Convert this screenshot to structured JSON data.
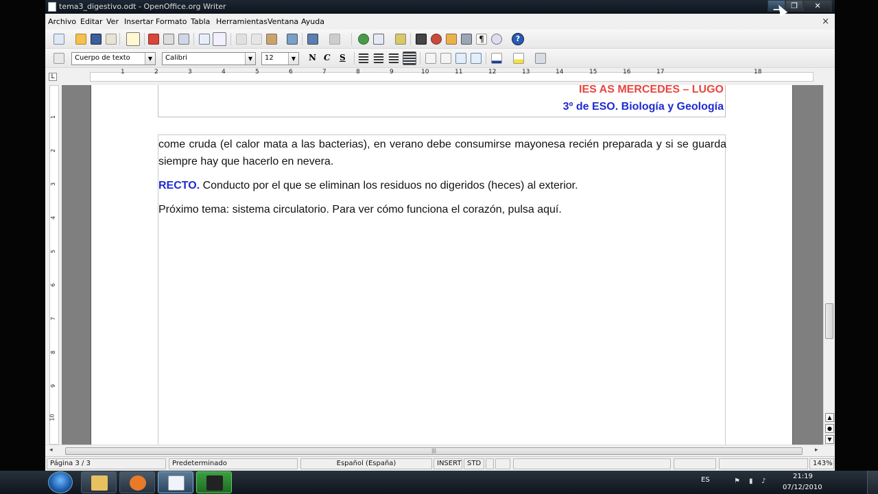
{
  "window": {
    "title": "tema3_digestivo.odt - OpenOffice.org Writer",
    "doc_close": "×"
  },
  "menu": [
    "Archivo",
    "Editar",
    "Ver",
    "Insertar",
    "Formato",
    "Tabla",
    "Herramientas",
    "Ventana",
    "Ayuda"
  ],
  "format_toolbar": {
    "style": "Cuerpo de texto",
    "font": "Calibri",
    "size": "12",
    "bold": "N",
    "italic": "C",
    "underline": "S"
  },
  "ruler": {
    "h_numbers": [
      "1",
      "2",
      "3",
      "4",
      "5",
      "6",
      "7",
      "8",
      "9",
      "10",
      "11",
      "12",
      "13",
      "14",
      "15",
      "16",
      "17",
      "18"
    ],
    "v_numbers": [
      "1",
      "2",
      "3",
      "4",
      "5",
      "6",
      "7",
      "8",
      "9",
      "10"
    ],
    "tab_selector": "L"
  },
  "document": {
    "header_line1": "IES AS MERCEDES – LUGO",
    "header_line2": "3º de ESO. Biología y Geología",
    "para1": "come cruda (el calor mata a las bacterias), en verano debe consumirse mayonesa recién preparada y si se guarda siempre hay que hacerlo en nevera.",
    "para2_keyword": "RECTO.",
    "para2_text": " Conducto por el que se eliminan los residuos no digeridos (heces) al exterior.",
    "para3": "Próximo tema: sistema circulatorio. Para ver cómo funciona el corazón, pulsa aquí."
  },
  "statusbar": {
    "page": "Página  3 / 3",
    "style": "Predeterminado",
    "language": "Español (España)",
    "insert": "INSERT",
    "std": "STD",
    "zoom": "143%"
  },
  "taskbar": {
    "lang": "ES",
    "time": "21:19",
    "date": "07/12/2010"
  },
  "colors": {
    "header_red": "#e8453f",
    "header_blue": "#1f2bd0",
    "keyword_blue": "#1f2bd0"
  }
}
